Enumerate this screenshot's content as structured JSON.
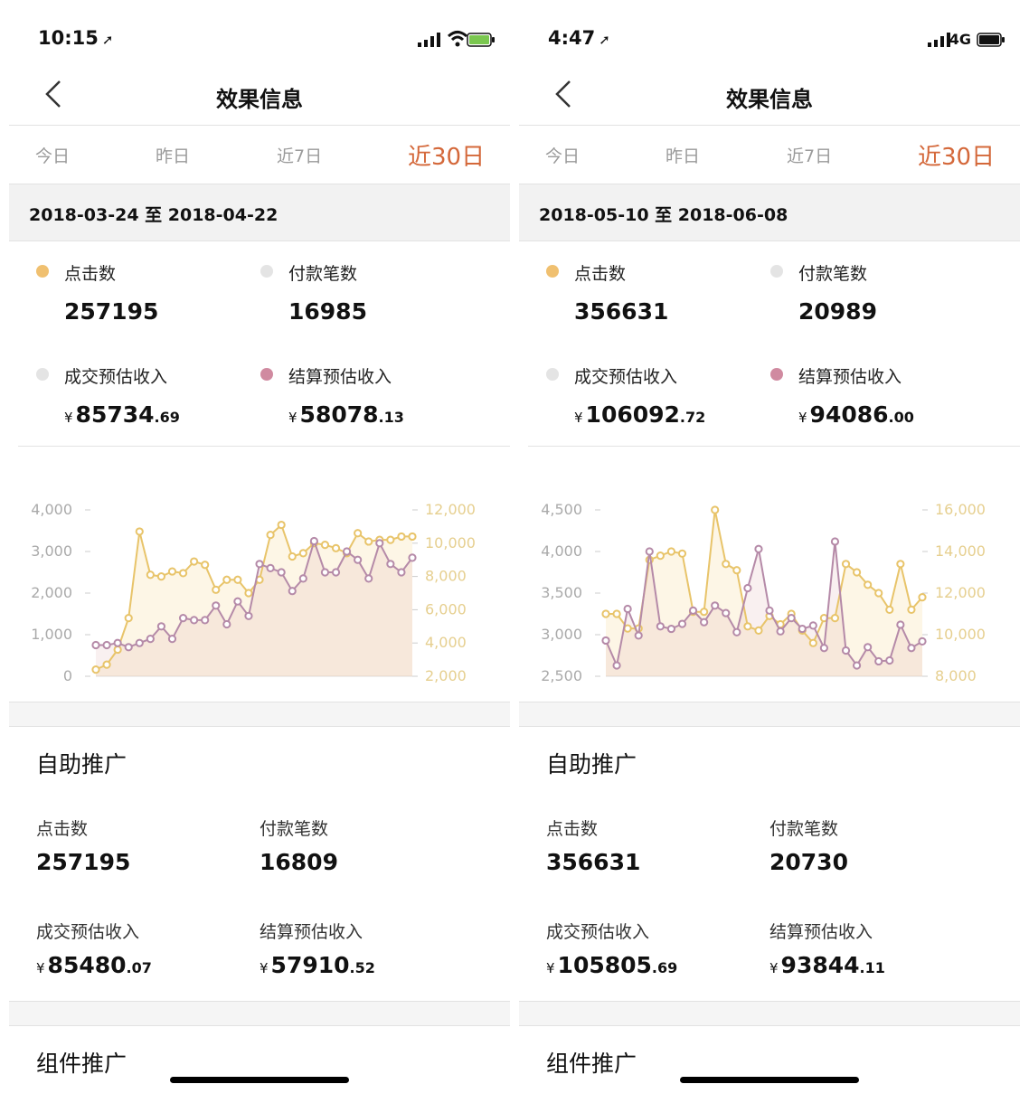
{
  "phones": [
    {
      "time": "10:15",
      "network": "",
      "title": "效果信息",
      "tabs": [
        "今日",
        "昨日",
        "近7日",
        "近30日"
      ],
      "active_tab": 3,
      "date_range": "2018-03-24 至 2018-04-22",
      "stats": [
        {
          "label": "点击数",
          "value": "257195",
          "color": "#f0c070"
        },
        {
          "label": "付款笔数",
          "value": "16985",
          "color": "#e4e4e4"
        },
        {
          "label": "成交预估收入",
          "yen": "¥",
          "int": "85734",
          "dec": ".69",
          "color": "#e4e4e4"
        },
        {
          "label": "结算预估收入",
          "yen": "¥",
          "int": "58078",
          "dec": ".13",
          "color": "#d08aa0"
        }
      ],
      "self_section": {
        "title": "自助推广",
        "items": [
          {
            "label": "点击数",
            "value": "257195"
          },
          {
            "label": "付款笔数",
            "value": "16809"
          },
          {
            "label": "成交预估收入",
            "yen": "¥",
            "int": "85480",
            "dec": ".07"
          },
          {
            "label": "结算预估收入",
            "yen": "¥",
            "int": "57910",
            "dec": ".52"
          }
        ]
      },
      "component_section": {
        "title": "组件推广"
      },
      "chart_data": {
        "type": "line",
        "left_axis": {
          "ticks": [
            "4,000",
            "3,000",
            "2,000",
            "1,000",
            "0"
          ],
          "min": 0,
          "max": 4000
        },
        "right_axis": {
          "ticks": [
            "12,000",
            "10,000",
            "8,000",
            "6,000",
            "4,000",
            "2,000"
          ],
          "min": 2000,
          "max": 12000
        },
        "x": [
          1,
          2,
          3,
          4,
          5,
          6,
          7,
          8,
          9,
          10,
          11,
          12,
          13,
          14,
          15,
          16,
          17,
          18,
          19,
          20,
          21,
          22,
          23,
          24,
          25,
          26,
          27,
          28,
          29,
          30
        ],
        "series": [
          {
            "axis": "right",
            "color": "#e8c46a",
            "values": [
              2400,
              2700,
              3600,
              5500,
              10700,
              8100,
              8000,
              8300,
              8200,
              8900,
              8700,
              7200,
              7800,
              7800,
              7000,
              7800,
              10500,
              11100,
              9200,
              9400,
              10000,
              9900,
              9700,
              9400,
              10600,
              10100,
              10200,
              10200,
              10400,
              10400
            ]
          },
          {
            "axis": "left",
            "color": "#b58aa8",
            "values": [
              750,
              750,
              800,
              700,
              800,
              900,
              1200,
              900,
              1400,
              1350,
              1350,
              1700,
              1250,
              1800,
              1450,
              2700,
              2600,
              2500,
              2050,
              2350,
              3250,
              2500,
              2500,
              3000,
              2800,
              2350,
              3200,
              2700,
              2500,
              2850
            ]
          }
        ]
      }
    },
    {
      "time": "4:47",
      "network": "4G",
      "title": "效果信息",
      "tabs": [
        "今日",
        "昨日",
        "近7日",
        "近30日"
      ],
      "active_tab": 3,
      "date_range": "2018-05-10 至 2018-06-08",
      "stats": [
        {
          "label": "点击数",
          "value": "356631",
          "color": "#f0c070"
        },
        {
          "label": "付款笔数",
          "value": "20989",
          "color": "#e4e4e4"
        },
        {
          "label": "成交预估收入",
          "yen": "¥",
          "int": "106092",
          "dec": ".72",
          "color": "#e4e4e4"
        },
        {
          "label": "结算预估收入",
          "yen": "¥",
          "int": "94086",
          "dec": ".00",
          "color": "#d08aa0"
        }
      ],
      "self_section": {
        "title": "自助推广",
        "items": [
          {
            "label": "点击数",
            "value": "356631"
          },
          {
            "label": "付款笔数",
            "value": "20730"
          },
          {
            "label": "成交预估收入",
            "yen": "¥",
            "int": "105805",
            "dec": ".69"
          },
          {
            "label": "结算预估收入",
            "yen": "¥",
            "int": "93844",
            "dec": ".11"
          }
        ]
      },
      "component_section": {
        "title": "组件推广"
      },
      "chart_data": {
        "type": "line",
        "left_axis": {
          "ticks": [
            "4,500",
            "4,000",
            "3,500",
            "3,000",
            "2,500"
          ],
          "min": 2500,
          "max": 4500
        },
        "right_axis": {
          "ticks": [
            "16,000",
            "14,000",
            "12,000",
            "10,000",
            "8,000"
          ],
          "min": 8000,
          "max": 16000
        },
        "x": [
          1,
          2,
          3,
          4,
          5,
          6,
          7,
          8,
          9,
          10,
          11,
          12,
          13,
          14,
          15,
          16,
          17,
          18,
          19,
          20,
          21,
          22,
          23,
          24,
          25,
          26,
          27,
          28,
          29,
          30
        ],
        "series": [
          {
            "axis": "right",
            "color": "#e8c46a",
            "values": [
              11000,
              11000,
              10300,
              10300,
              13600,
              13800,
              14000,
              13900,
              11100,
              11100,
              16000,
              13400,
              13100,
              10400,
              10200,
              10900,
              10500,
              11000,
              10200,
              9600,
              10800,
              10800,
              13400,
              13000,
              12400,
              12000,
              11200,
              13400,
              11200,
              11800
            ]
          },
          {
            "axis": "left",
            "color": "#b58aa8",
            "values": [
              2930,
              2630,
              3310,
              2990,
              4000,
              3100,
              3070,
              3130,
              3290,
              3150,
              3350,
              3260,
              3030,
              3560,
              4030,
              3290,
              3040,
              3200,
              3070,
              3110,
              2840,
              4120,
              2810,
              2630,
              2850,
              2680,
              2690,
              3120,
              2840,
              2920
            ]
          }
        ]
      }
    }
  ]
}
